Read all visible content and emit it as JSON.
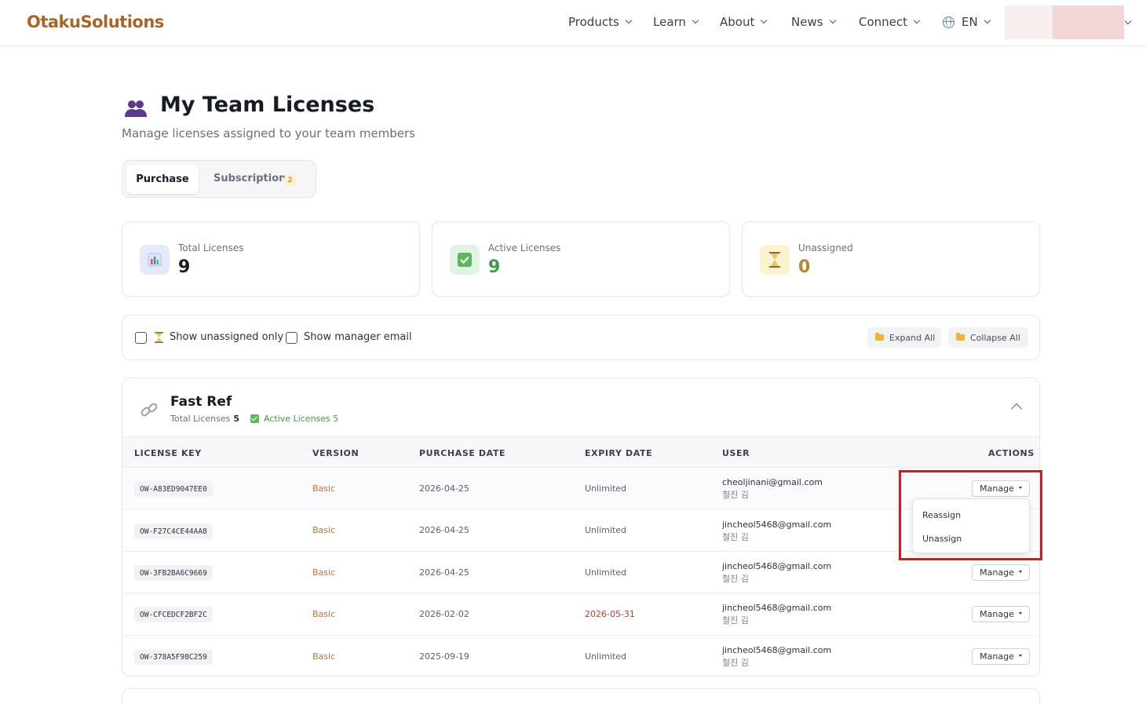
{
  "brand": "OtakuSolutions",
  "nav": {
    "items": [
      "Products",
      "Learn",
      "About",
      "News",
      "Connect"
    ],
    "language": "EN"
  },
  "page": {
    "title": "My Team Licenses",
    "subtitle": "Manage licenses assigned to your team members"
  },
  "tabs": {
    "purchase": "Purchase",
    "subscription": "Subscription",
    "subscription_count": "2"
  },
  "stats": {
    "total_label": "Total Licenses",
    "total_value": "9",
    "active_label": "Active Licenses",
    "active_value": "9",
    "unassigned_label": "Unassigned",
    "unassigned_value": "0"
  },
  "filters": {
    "unassigned_only": "Show unassigned only",
    "manager_email": "Show manager email",
    "expand_all": "Expand All",
    "collapse_all": "Collapse All"
  },
  "product": {
    "name": "Fast Ref",
    "total_label": "Total Licenses",
    "total_value": "5",
    "active_label": "Active Licenses 5"
  },
  "table": {
    "headers": [
      "LICENSE KEY",
      "VERSION",
      "PURCHASE DATE",
      "EXPIRY DATE",
      "USER",
      "ACTIONS"
    ],
    "manage_label": "Manage",
    "rows": [
      {
        "key": "OW-A83ED9047EE0",
        "version": "Basic",
        "purchase": "2026-04-25",
        "expiry": "Unlimited",
        "email": "cheoljinani@gmail.com",
        "name": "철진 김"
      },
      {
        "key": "OW-F27C4CE44AA8",
        "version": "Basic",
        "purchase": "2026-04-25",
        "expiry": "Unlimited",
        "email": "jincheol5468@gmail.com",
        "name": "철진 김"
      },
      {
        "key": "OW-3FB2BA6C9669",
        "version": "Basic",
        "purchase": "2026-04-25",
        "expiry": "Unlimited",
        "email": "jincheol5468@gmail.com",
        "name": "철진 김"
      },
      {
        "key": "OW-CFCEDCF2BF2C",
        "version": "Basic",
        "purchase": "2026-02-02",
        "expiry": "2026-05-31",
        "email": "jincheol5468@gmail.com",
        "name": "철진 김"
      },
      {
        "key": "OW-378A5F98C259",
        "version": "Basic",
        "purchase": "2025-09-19",
        "expiry": "Unlimited",
        "email": "jincheol5468@gmail.com",
        "name": "철진 김"
      }
    ]
  },
  "dropdown": {
    "reassign": "Reassign",
    "unassign": "Unassign"
  },
  "colors": {
    "brand": "#a8652a",
    "active_green": "#3f9a4f",
    "unassigned_gold": "#b5862a",
    "expiry_red": "#c0392b",
    "highlight_red": "#e0141e"
  }
}
